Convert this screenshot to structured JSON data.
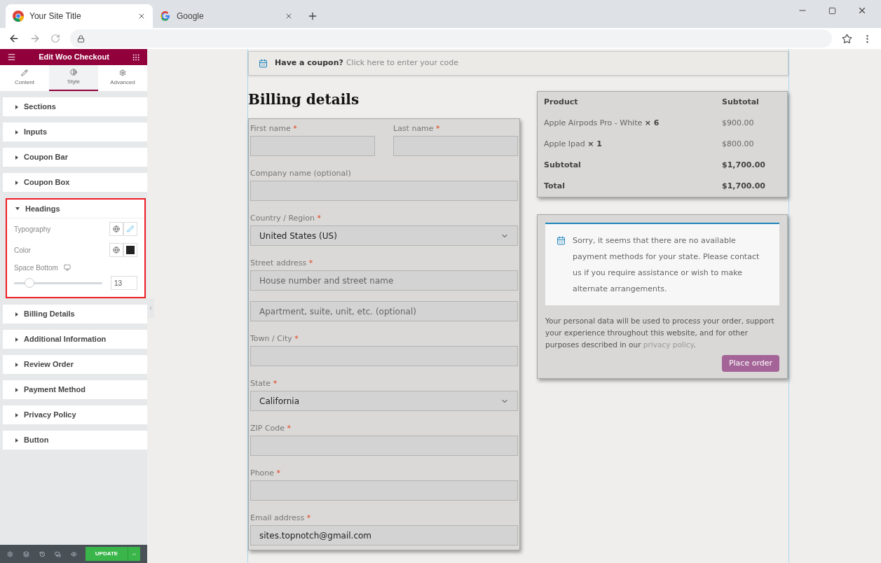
{
  "browser": {
    "tabs": [
      {
        "title": "Your Site Title",
        "selected": true,
        "kind": "chrome"
      },
      {
        "title": "Google",
        "selected": false,
        "kind": "google"
      }
    ]
  },
  "editor": {
    "title": "Edit Woo Checkout",
    "tabs": [
      {
        "label": "Content",
        "selected": false,
        "kind": "pencil"
      },
      {
        "label": "Style",
        "selected": true,
        "kind": "contrast"
      },
      {
        "label": "Advanced",
        "selected": false,
        "kind": "gear"
      }
    ],
    "sections": [
      {
        "label": "Sections",
        "expanded": false
      },
      {
        "label": "Inputs",
        "expanded": false
      },
      {
        "label": "Coupon Bar",
        "expanded": false
      },
      {
        "label": "Coupon Box",
        "expanded": false
      },
      {
        "label": "Headings",
        "expanded": true,
        "typography": "Typography",
        "color_label": "Color",
        "space_bottom": "Space Bottom",
        "level": 0.13,
        "value": "13"
      },
      {
        "label": "Billing Details",
        "expanded": false
      },
      {
        "label": "Additional Information",
        "expanded": false
      },
      {
        "label": "Review Order",
        "expanded": false
      },
      {
        "label": "Payment Method",
        "expanded": false
      },
      {
        "label": "Privacy Policy",
        "expanded": false
      },
      {
        "label": "Button",
        "expanded": false
      }
    ],
    "update": "UPDATE"
  },
  "checkout": {
    "coupon": {
      "text": "Have a coupon?",
      "link": "Click here to enter your code"
    },
    "heading": "Billing details",
    "rows": [
      {
        "fields": [
          {
            "label": "First name",
            "mark": "*",
            "kind": "input"
          },
          {
            "label": "Last name",
            "mark": "*",
            "kind": "input"
          }
        ]
      },
      {
        "fields": [
          {
            "label": "Company name (optional)",
            "kind": "input"
          }
        ]
      },
      {
        "fields": [
          {
            "label": "Country / Region",
            "mark": "*",
            "kind": "select",
            "value": "United States (US)"
          }
        ]
      },
      {
        "fields": [
          {
            "label": "Street address",
            "mark": "*",
            "kind": "input",
            "placeholder": "House number and street name"
          }
        ]
      },
      {
        "fields": [
          {
            "kind": "input",
            "placeholder": "Apartment, suite, unit, etc. (optional)"
          }
        ]
      },
      {
        "fields": [
          {
            "label": "Town / City",
            "mark": "*",
            "kind": "input"
          }
        ]
      },
      {
        "fields": [
          {
            "label": "State",
            "mark": "*",
            "kind": "select",
            "value": "California"
          }
        ]
      },
      {
        "fields": [
          {
            "label": "ZIP Code",
            "mark": "*",
            "kind": "input"
          }
        ]
      },
      {
        "fields": [
          {
            "label": "Phone",
            "mark": "*",
            "kind": "input"
          }
        ]
      },
      {
        "fields": [
          {
            "label": "Email address",
            "mark": "*",
            "kind": "input",
            "value": "sites.topnotch@gmail.com"
          }
        ]
      }
    ],
    "order": {
      "columns": [
        "Product",
        "Subtotal"
      ],
      "items": [
        {
          "product": "Apple Airpods Pro - White",
          "qty": "× 6",
          "price": "$900.00"
        },
        {
          "product": "Apple Ipad",
          "qty": "× 1",
          "price": "$800.00"
        }
      ],
      "totals": [
        {
          "label": "Subtotal",
          "amount": "$1,700.00"
        },
        {
          "label": "Total",
          "amount": "$1,700.00"
        }
      ]
    },
    "payment_notice": "Sorry, it seems that there are no available payment methods for your state. Please contact us if you require assistance or wish to make alternate arrangements.",
    "privacy": {
      "text": "Your personal data will be used to process your order, support your experience throughout this website, and for other purposes described in our",
      "link": "privacy policy",
      "end": "."
    },
    "place_order": "Place order"
  }
}
